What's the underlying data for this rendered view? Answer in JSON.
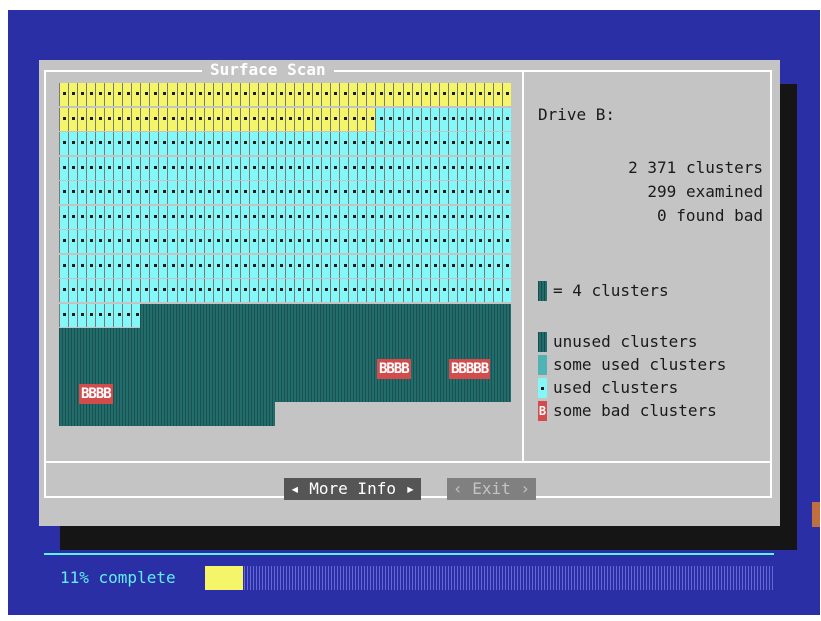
{
  "dialog": {
    "title": "Surface Scan",
    "drive_label": "Drive B:",
    "stats": {
      "clusters": "2 371 clusters",
      "examined": "299 examined",
      "bad": "0 found bad"
    },
    "scale_text": "= 4 clusters",
    "legend": [
      {
        "label": "unused clusters",
        "swatch": "unused"
      },
      {
        "label": "some used clusters",
        "swatch": "some"
      },
      {
        "label": "used clusters",
        "swatch": "used"
      },
      {
        "label": "some bad clusters",
        "swatch": "bad"
      }
    ],
    "bad_markers": [
      "BBBB",
      "BBBBB",
      "BBBB"
    ],
    "buttons": {
      "more_info": "More Info",
      "exit": "Exit"
    }
  },
  "progress": {
    "text": "11% complete",
    "fraction": 0.11
  },
  "colors": {
    "background": "#2b2fa6",
    "dialog": "#c4c4c4",
    "yellow": "#f5f56a",
    "cyan": "#84f8f8",
    "unused": "#236c6c",
    "bad": "#d44b4b"
  }
}
